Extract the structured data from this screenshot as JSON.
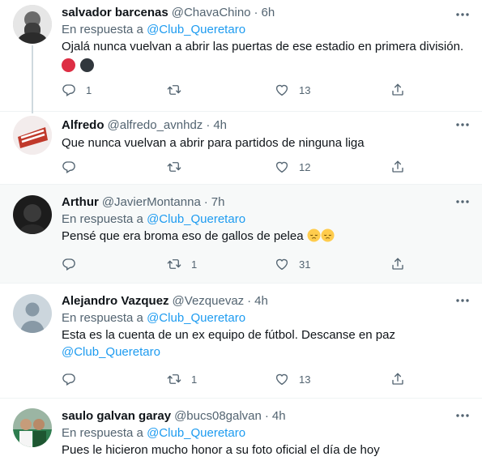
{
  "tweets": [
    {
      "name": "salvador barcenas",
      "handle": "@ChavaChino",
      "time": "6h",
      "reply_prefix": "En respuesta a",
      "reply_to": "@Club_Queretaro",
      "text": "Ojalá nunca vuelvan a abrir las puertas de ese estadio en primera división.",
      "reply_count": "1",
      "retweet_count": "",
      "like_count": "13"
    },
    {
      "name": "Alfredo",
      "handle": "@alfredo_avnhdz",
      "time": "4h",
      "text": "Que nunca vuelvan a abrir para partidos de ninguna liga",
      "reply_count": "",
      "retweet_count": "",
      "like_count": "12"
    },
    {
      "name": "Arthur",
      "handle": "@JavierMontanna",
      "time": "7h",
      "reply_prefix": "En respuesta a",
      "reply_to": "@Club_Queretaro",
      "text": "Pensé que era broma eso de gallos de pelea",
      "reply_count": "",
      "retweet_count": "1",
      "like_count": "31"
    },
    {
      "name": "Alejandro Vazquez",
      "handle": "@Vezquevaz",
      "time": "4h",
      "reply_prefix": "En respuesta a",
      "reply_to": "@Club_Queretaro",
      "text": "Esta es la cuenta de un ex equipo de fútbol. Descanse en paz",
      "text_mention": "@Club_Queretaro",
      "reply_count": "",
      "retweet_count": "1",
      "like_count": "13"
    },
    {
      "name": "saulo galvan garay",
      "handle": "@bucs08galvan",
      "time": "4h",
      "reply_prefix": "En respuesta a",
      "reply_to": "@Club_Queretaro",
      "text": "Pues le hicieron mucho honor a su foto oficial el día de hoy"
    }
  ],
  "separator": "·",
  "colors": {
    "accent": "#1d9bf0",
    "muted": "#536471",
    "highlight_bg": "#f7f9f9"
  }
}
